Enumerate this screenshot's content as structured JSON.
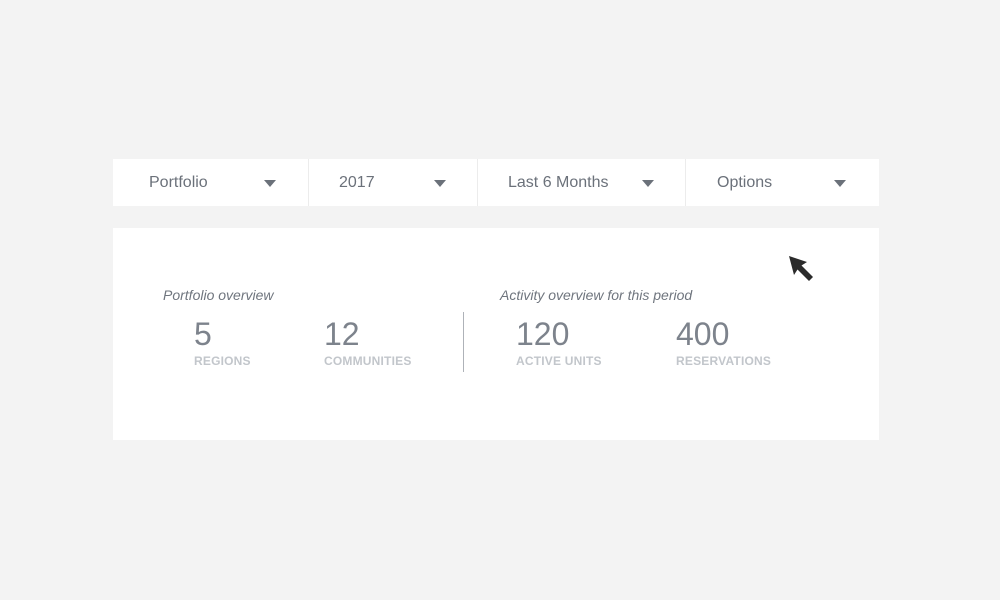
{
  "filters": [
    {
      "label": "Portfolio"
    },
    {
      "label": "2017"
    },
    {
      "label": "Last 6 Months"
    },
    {
      "label": "Options"
    }
  ],
  "overview": {
    "portfolio_title": "Portfolio overview",
    "activity_title": "Activity overview for this period",
    "metrics": {
      "regions": {
        "value": "5",
        "label": "REGIONS"
      },
      "communities": {
        "value": "12",
        "label": "COMMUNITIES"
      },
      "active_units": {
        "value": "120",
        "label": "ACTIVE UNITS"
      },
      "reservations": {
        "value": "400",
        "label": "RESERVATIONS"
      }
    }
  },
  "icons": {
    "dropdown_caret": "caret-down-icon",
    "cursor": "mouse-pointer-icon"
  },
  "colors": {
    "page_background": "#f3f3f3",
    "panel_background": "#ffffff",
    "text": "#6b717a",
    "metric_label": "#c2c6cb"
  }
}
